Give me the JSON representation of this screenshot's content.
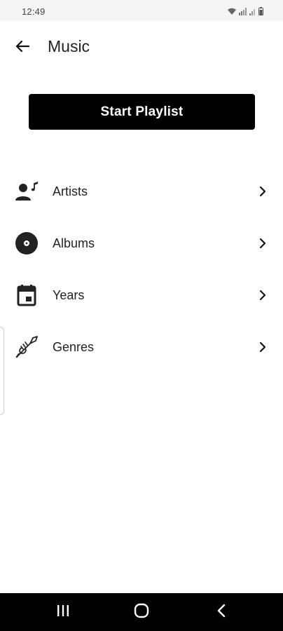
{
  "status_bar": {
    "time": "12:49"
  },
  "header": {
    "title": "Music",
    "back_icon": "arrow-left-icon"
  },
  "start_playlist": {
    "label": "Start Playlist"
  },
  "menu": {
    "items": [
      {
        "label": "Artists",
        "icon": "artist-icon"
      },
      {
        "label": "Albums",
        "icon": "album-disc-icon"
      },
      {
        "label": "Years",
        "icon": "calendar-icon"
      },
      {
        "label": "Genres",
        "icon": "trumpet-icon"
      }
    ]
  },
  "nav_bar": {
    "recents_icon": "recents-icon",
    "home_icon": "home-icon",
    "back_icon": "back-chevron-icon"
  },
  "colors": {
    "primary_button": "#000000",
    "background": "#ffffff",
    "status_bar": "#f4f4f4",
    "nav_bar": "#000000"
  }
}
